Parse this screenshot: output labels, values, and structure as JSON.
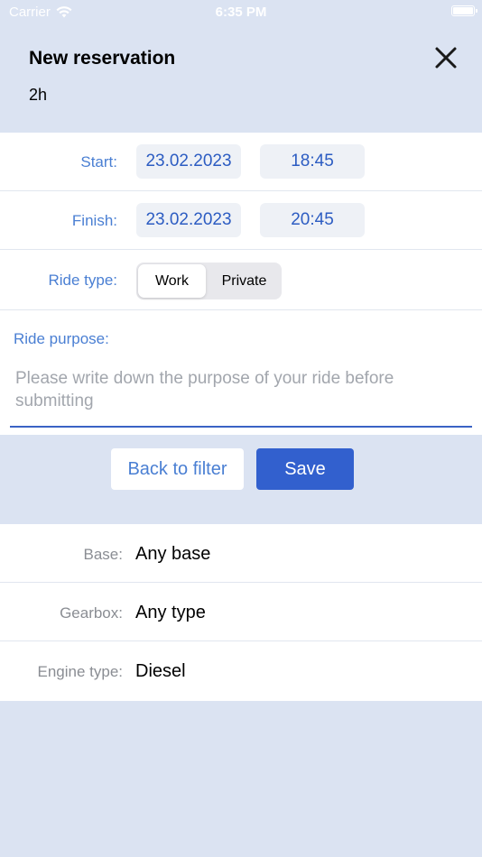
{
  "status_bar": {
    "carrier": "Carrier",
    "time": "6:35 PM",
    "wifi_icon": "wifi-icon",
    "battery_icon": "battery-icon"
  },
  "header": {
    "title": "New reservation",
    "duration": "2h",
    "close_icon": "close-icon"
  },
  "schedule": {
    "start_label": "Start:",
    "start_date": "23.02.2023",
    "start_time": "18:45",
    "finish_label": "Finish:",
    "finish_date": "23.02.2023",
    "finish_time": "20:45"
  },
  "ride_type": {
    "label": "Ride type:",
    "options": [
      "Work",
      "Private"
    ],
    "selected": "Work"
  },
  "ride_purpose": {
    "label": "Ride purpose:",
    "value": "",
    "placeholder": "Please write down the purpose of your ride before submitting"
  },
  "actions": {
    "back_label": "Back to filter",
    "save_label": "Save"
  },
  "filters": [
    {
      "label": "Base:",
      "value": "Any base"
    },
    {
      "label": "Gearbox:",
      "value": "Any type"
    },
    {
      "label": "Engine type:",
      "value": "Diesel"
    }
  ],
  "colors": {
    "background": "#dbe3f2",
    "accent": "#3260ce",
    "label_blue": "#4a7fd3",
    "pill_text": "#2c5cc2"
  }
}
